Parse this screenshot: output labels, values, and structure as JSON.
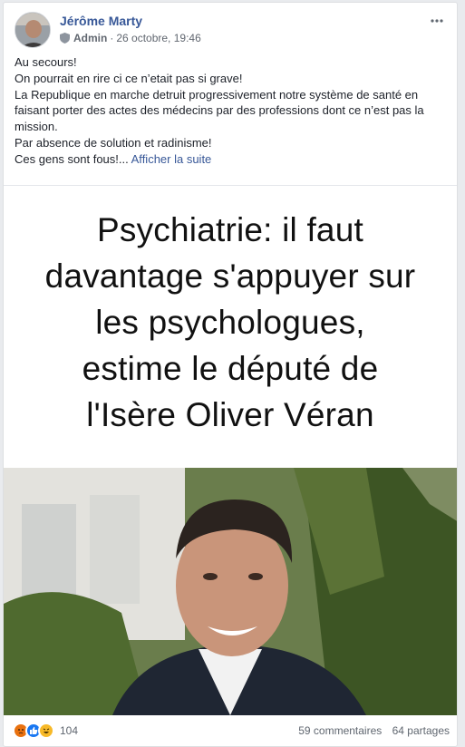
{
  "post": {
    "author": "Jérôme Marty",
    "role": "Admin",
    "separator": "·",
    "date": "26 octobre, 19:46",
    "text_lines": [
      "Au secours!",
      "On pourrait en rire ci ce n’etait pas si grave!",
      "La Republique en marche detruit progressivement notre système de santé en faisant porter des actes des médecins par des professions dont ce n’est pas la mission.",
      "Par absence de solution et radinisme!",
      "Ces gens sont fous!..."
    ],
    "see_more": "Afficher la suite",
    "headline_lines": [
      "Psychiatrie: il faut",
      "davantage s'appuyer sur",
      "les psychologues,",
      "estime le député de",
      "l'Isère Oliver Véran"
    ]
  },
  "footer": {
    "reaction_icons": [
      "angry-icon",
      "like-icon",
      "haha-icon"
    ],
    "reaction_count": "104",
    "comments": "59 commentaires",
    "shares": "64 partages"
  },
  "colors": {
    "link": "#385898",
    "meta": "#616770",
    "like": "#1877f2",
    "angry": "#e9710f",
    "haha": "#f7b928"
  }
}
